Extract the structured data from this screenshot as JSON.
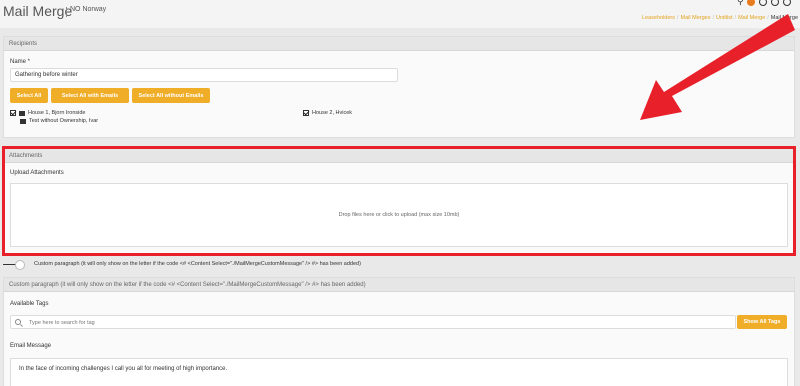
{
  "header": {
    "title": "Mail Merge",
    "subtitle": "NO Norway",
    "breadcrumb": [
      "Leaseholders",
      "Mail Merges",
      "Unitlist",
      "Mail Merge",
      "Mail Merge"
    ]
  },
  "recipients": {
    "heading": "Recipients",
    "name_label": "Name *",
    "name_value": "Gathering before winter",
    "buttons": {
      "select_all": "Select All",
      "select_with_emails": "Select All with Emails",
      "select_without_emails": "Select All without Emails"
    },
    "items": [
      {
        "label": "House 1, Bjorn Ironside",
        "checked": true,
        "icon": "envelope-icon"
      },
      {
        "label": "Test without Ownership, Ivar",
        "checked": false,
        "icon": "envelope-icon"
      },
      {
        "label": "House 2, Hvicek",
        "checked": true,
        "icon": "envelope-icon"
      }
    ]
  },
  "attachments": {
    "heading": "Attachments",
    "upload_label": "Upload Attachments",
    "dropzone_text": "Drop files here or click to upload (max size 10mb)"
  },
  "toggle": {
    "label": "Custom paragraph (it will only show on the letter if the code <# <Content Select=\"./MailMergeCustomMessage\" /> #> has been added)"
  },
  "custom": {
    "heading": "Custom paragraph (it will only show on the letter if the code <# <Content Select=\"./MailMergeCustomMessage\" /> #> has been added)",
    "available_tags_label": "Available Tags",
    "search_placeholder": "Type here to search for tag",
    "show_all_tags": "Show All Tags",
    "email_message_label": "Email Message",
    "email_message": "In the face of incoming challenges I call you all for meeting of high importance."
  },
  "colors": {
    "accent": "#f0ad28",
    "highlight": "#e8202a"
  }
}
